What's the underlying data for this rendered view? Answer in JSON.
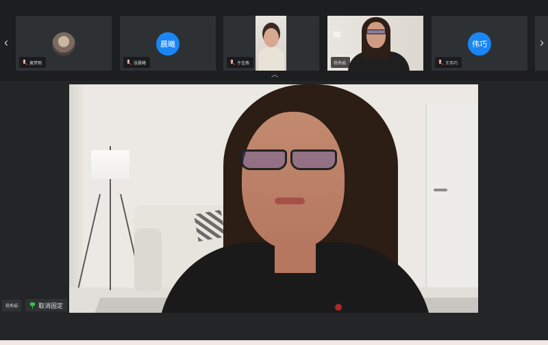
{
  "participant_strip": {
    "prev_label": "‹",
    "next_label": "›",
    "collapse_label": "︿",
    "tiles": [
      {
        "name": "黄梦雨",
        "avatar_type": "photo",
        "muted": true
      },
      {
        "name": "张晨曦",
        "avatar_text": "晨曦",
        "avatar_type": "initials",
        "avatar_color": "#1a86f5",
        "muted": true
      },
      {
        "name": "于佳燕",
        "avatar_type": "video",
        "muted": true
      },
      {
        "name": "杨秀娟",
        "avatar_type": "video",
        "muted": false
      },
      {
        "name": "王伟巧",
        "avatar_text": "伟巧",
        "avatar_type": "initials",
        "avatar_color": "#1a86f5",
        "muted": true
      }
    ]
  },
  "main_video": {
    "active_speaker_name": "杨秀娟",
    "unpin_label": "取消固定",
    "unpin_icon": "pin-icon",
    "pin_color": "#37c24a"
  },
  "colors": {
    "background": "#232527",
    "tile_bg": "#2e3134",
    "accent": "#1a86f5"
  }
}
